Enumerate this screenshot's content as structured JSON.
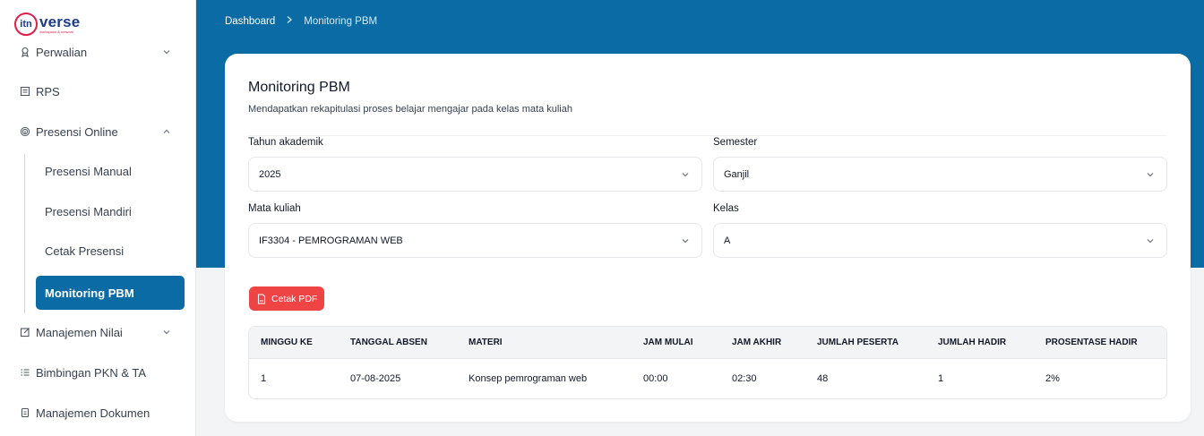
{
  "logo": {
    "mark": "itn",
    "word": "verse",
    "tagline": "workspace & network"
  },
  "sidebar": {
    "items": [
      {
        "label": "Perwalian",
        "icon": "award-icon",
        "chevron": "down"
      },
      {
        "label": "RPS",
        "icon": "book-icon"
      },
      {
        "label": "Presensi Online",
        "icon": "fingerprint-icon",
        "chevron": "up"
      },
      {
        "label": "Manajemen Nilai",
        "icon": "edit-icon",
        "chevron": "down"
      },
      {
        "label": "Bimbingan PKN & TA",
        "icon": "list-icon"
      },
      {
        "label": "Manajemen Dokumen",
        "icon": "document-icon"
      }
    ],
    "subitems": [
      {
        "label": "Presensi Manual",
        "active": false
      },
      {
        "label": "Presensi Mandiri",
        "active": false
      },
      {
        "label": "Cetak Presensi",
        "active": false
      },
      {
        "label": "Monitoring PBM",
        "active": true
      }
    ]
  },
  "breadcrumb": {
    "home": "Dashboard",
    "current": "Monitoring PBM"
  },
  "page": {
    "title": "Monitoring PBM",
    "subtitle": "Mendapatkan rekapitulasi proses belajar mengajar pada kelas mata kuliah"
  },
  "filters": {
    "tahun": {
      "label": "Tahun akademik",
      "value": "2025"
    },
    "semester": {
      "label": "Semester",
      "value": "Ganjil"
    },
    "matkul": {
      "label": "Mata kuliah",
      "value": "IF3304 - PEMROGRAMAN WEB"
    },
    "kelas": {
      "label": "Kelas",
      "value": "A"
    }
  },
  "actions": {
    "print_pdf": "Cetak PDF"
  },
  "table": {
    "headers": [
      "MINGGU KE",
      "TANGGAL ABSEN",
      "MATERI",
      "JAM MULAI",
      "JAM AKHIR",
      "JUMLAH PESERTA",
      "JUMLAH HADIR",
      "PROSENTASE HADIR"
    ],
    "rows": [
      [
        "1",
        "07-08-2025",
        "Konsep pemrograman web",
        "00:00",
        "02:30",
        "48",
        "1",
        "2%"
      ]
    ]
  },
  "colors": {
    "primary": "#0b6ba4",
    "danger": "#ef4444",
    "background": "#f3f4f6"
  }
}
